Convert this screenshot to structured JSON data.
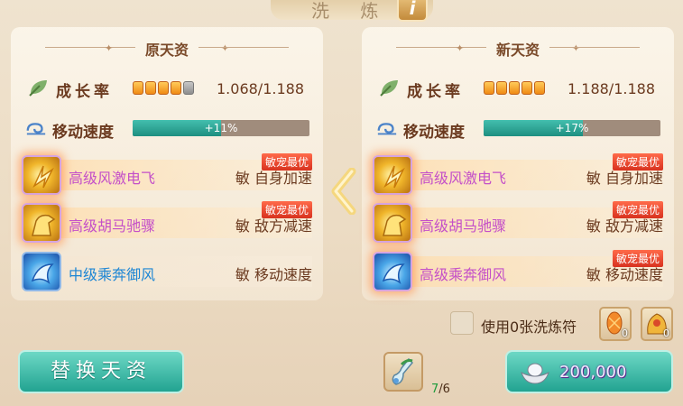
{
  "header": {
    "title": "洗 炼",
    "info_icon": "i"
  },
  "left_panel": {
    "title": "原天资",
    "growth": {
      "label": "成长率",
      "value": "1.068/1.188",
      "pips_on": 4,
      "pips_total": 5
    },
    "speed": {
      "label": "移动速度",
      "bonus": "+11%",
      "fill": 0.5
    },
    "skills": [
      {
        "name": "高级风激电飞",
        "attr": "敏  自身加速",
        "badge": "敏宠最优",
        "tier": "gold"
      },
      {
        "name": "高级胡马驰骤",
        "attr": "敏  敌方减速",
        "badge": "敏宠最优",
        "tier": "gold"
      },
      {
        "name": "中级乘奔御风",
        "attr": "敏  移动速度",
        "badge": "",
        "tier": "blue"
      }
    ]
  },
  "right_panel": {
    "title": "新天资",
    "growth": {
      "label": "成长率",
      "value": "1.188/1.188",
      "pips_on": 5,
      "pips_total": 5
    },
    "speed": {
      "label": "移动速度",
      "bonus": "+17%",
      "fill": 0.56
    },
    "skills": [
      {
        "name": "高级风激电飞",
        "attr": "敏  自身加速",
        "badge": "敏宠最优",
        "tier": "gold"
      },
      {
        "name": "高级胡马驰骤",
        "attr": "敏  敌方减速",
        "badge": "敏宠最优",
        "tier": "gold"
      },
      {
        "name": "高级乘奔御风",
        "attr": "敏  移动速度",
        "badge": "敏宠最优",
        "tier": "gold-blue"
      }
    ]
  },
  "bottom": {
    "use_label": "使用0张洗炼符",
    "items": [
      {
        "icon": "fish-charm-icon",
        "count": "0"
      },
      {
        "icon": "dragon-charm-icon",
        "count": "0"
      }
    ],
    "replace_label": "替换天资",
    "potion": {
      "icon": "potion-icon",
      "have": "7",
      "need": "/6"
    },
    "wash_cost": "200,000"
  },
  "colors": {
    "accent": "#22a391",
    "pink_text": "#c44fc8",
    "blue_text": "#1d86d4",
    "badge": "#d8321f"
  }
}
